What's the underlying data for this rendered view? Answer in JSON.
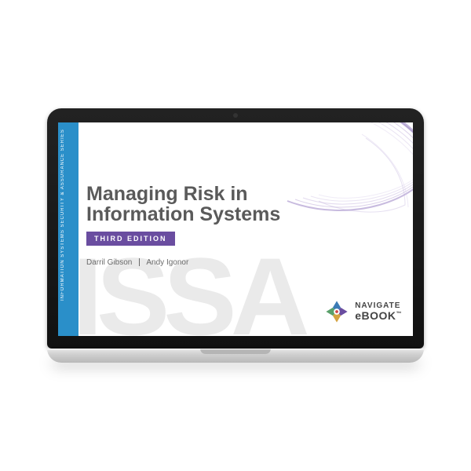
{
  "product": {
    "device": "laptop-mockup",
    "spine": {
      "series_text": "INFORMATION SYSTEMS SECURITY & ASSURANCE SERIES",
      "series_abbr": "ISSA"
    },
    "cover": {
      "title_line1": "Managing Risk in",
      "title_line2": "Information Systems",
      "edition_label": "THIRD EDITION",
      "authors": [
        "Darril Gibson",
        "Andy Igonor"
      ]
    },
    "badge": {
      "brand_line1": "NAVIGATE",
      "brand_line2": "eBOOK",
      "tm": "™"
    },
    "colors": {
      "spine": "#2a8fc9",
      "edition_bg": "#6a4da0",
      "title": "#5a5a5a",
      "swirl": "#b9a6d6"
    }
  }
}
